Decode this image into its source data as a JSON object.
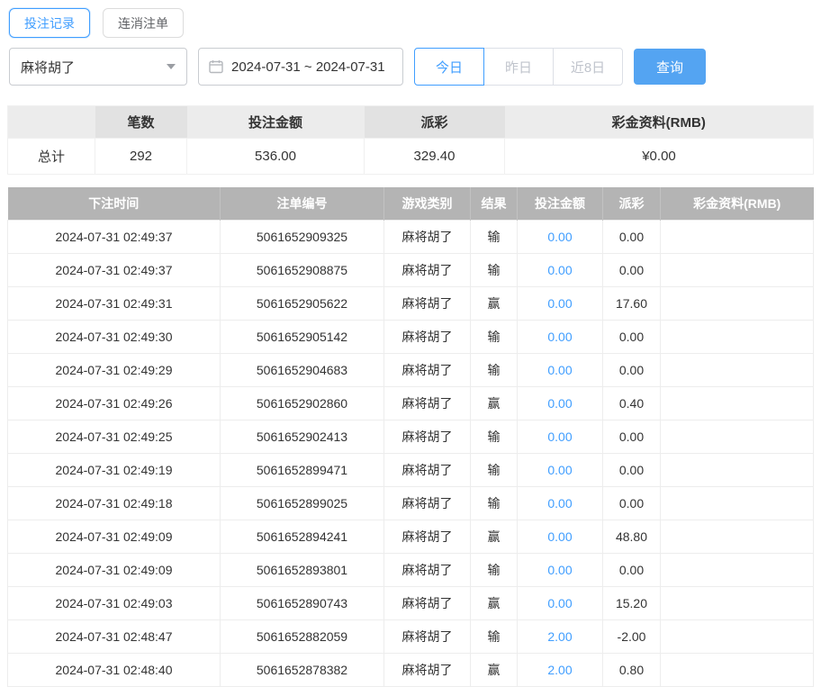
{
  "colors": {
    "accent": "#409eff",
    "query_button": "#54a4f2",
    "table_header_bg": "#b4b4b4",
    "negative": "#f05050",
    "link": "#409eff"
  },
  "tabs": [
    {
      "label": "投注记录",
      "active": true
    },
    {
      "label": "连消注单",
      "active": false
    }
  ],
  "filters": {
    "game_select": "麻将胡了",
    "date_range": "2024-07-31 ~ 2024-07-31",
    "quick_buttons": [
      {
        "label": "今日",
        "active": true
      },
      {
        "label": "昨日",
        "active": false
      },
      {
        "label": "近8日",
        "active": false
      }
    ],
    "search_label": "查询"
  },
  "summary": {
    "headers": [
      "",
      "笔数",
      "投注金额",
      "派彩",
      "彩金资料(RMB)"
    ],
    "row_label": "总计",
    "count": "292",
    "bet_amount": "536.00",
    "payout": "329.40",
    "bonus": "¥0.00"
  },
  "table": {
    "headers": [
      "下注时间",
      "注单编号",
      "游戏类别",
      "结果",
      "投注金额",
      "派彩",
      "彩金资料(RMB)"
    ],
    "rows": [
      {
        "time": "2024-07-31 02:49:37",
        "order": "5061652909325",
        "game": "麻将胡了",
        "result": "输",
        "bet": "0.00",
        "payout": "0.00",
        "bonus": ""
      },
      {
        "time": "2024-07-31 02:49:37",
        "order": "5061652908875",
        "game": "麻将胡了",
        "result": "输",
        "bet": "0.00",
        "payout": "0.00",
        "bonus": ""
      },
      {
        "time": "2024-07-31 02:49:31",
        "order": "5061652905622",
        "game": "麻将胡了",
        "result": "赢",
        "bet": "0.00",
        "payout": "17.60",
        "bonus": ""
      },
      {
        "time": "2024-07-31 02:49:30",
        "order": "5061652905142",
        "game": "麻将胡了",
        "result": "输",
        "bet": "0.00",
        "payout": "0.00",
        "bonus": ""
      },
      {
        "time": "2024-07-31 02:49:29",
        "order": "5061652904683",
        "game": "麻将胡了",
        "result": "输",
        "bet": "0.00",
        "payout": "0.00",
        "bonus": ""
      },
      {
        "time": "2024-07-31 02:49:26",
        "order": "5061652902860",
        "game": "麻将胡了",
        "result": "赢",
        "bet": "0.00",
        "payout": "0.40",
        "bonus": ""
      },
      {
        "time": "2024-07-31 02:49:25",
        "order": "5061652902413",
        "game": "麻将胡了",
        "result": "输",
        "bet": "0.00",
        "payout": "0.00",
        "bonus": ""
      },
      {
        "time": "2024-07-31 02:49:19",
        "order": "5061652899471",
        "game": "麻将胡了",
        "result": "输",
        "bet": "0.00",
        "payout": "0.00",
        "bonus": ""
      },
      {
        "time": "2024-07-31 02:49:18",
        "order": "5061652899025",
        "game": "麻将胡了",
        "result": "输",
        "bet": "0.00",
        "payout": "0.00",
        "bonus": ""
      },
      {
        "time": "2024-07-31 02:49:09",
        "order": "5061652894241",
        "game": "麻将胡了",
        "result": "赢",
        "bet": "0.00",
        "payout": "48.80",
        "bonus": ""
      },
      {
        "time": "2024-07-31 02:49:09",
        "order": "5061652893801",
        "game": "麻将胡了",
        "result": "输",
        "bet": "0.00",
        "payout": "0.00",
        "bonus": ""
      },
      {
        "time": "2024-07-31 02:49:03",
        "order": "5061652890743",
        "game": "麻将胡了",
        "result": "赢",
        "bet": "0.00",
        "payout": "15.20",
        "bonus": ""
      },
      {
        "time": "2024-07-31 02:48:47",
        "order": "5061652882059",
        "game": "麻将胡了",
        "result": "输",
        "bet": "2.00",
        "payout": "-2.00",
        "bonus": ""
      },
      {
        "time": "2024-07-31 02:48:40",
        "order": "5061652878382",
        "game": "麻将胡了",
        "result": "赢",
        "bet": "2.00",
        "payout": "0.80",
        "bonus": ""
      }
    ]
  }
}
